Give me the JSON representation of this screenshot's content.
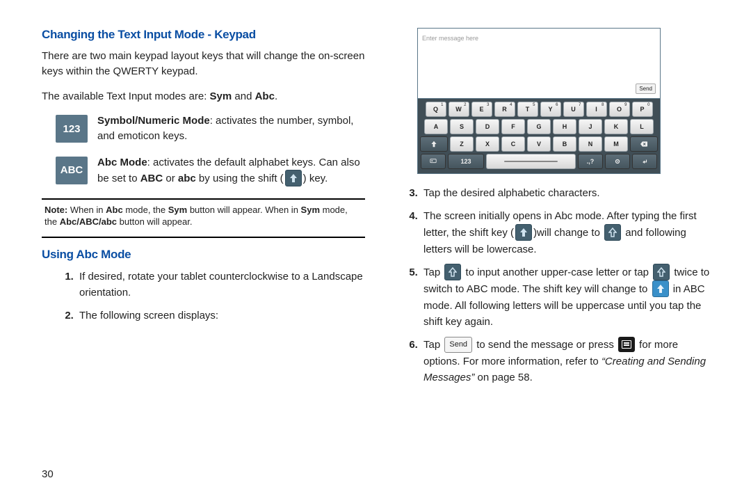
{
  "page_number": "30",
  "left": {
    "heading1": "Changing the Text Input Mode - Keypad",
    "para1": "There are two main keypad layout keys that will change the on-screen keys within the QWERTY keypad.",
    "para2_a": "The available Text Input modes are: ",
    "para2_sym": "Sym",
    "para2_and": " and ",
    "para2_abc": "Abc",
    "para2_end": ".",
    "mode123_badge": "123",
    "mode123_bold": "Symbol/Numeric Mode",
    "mode123_text": ": activates the number, symbol, and emoticon keys.",
    "modeABC_badge": "ABC",
    "modeABC_bold": "Abc Mode",
    "modeABC_text_a": ": activates the default alphabet keys. Can also be set to ",
    "modeABC_text_abc1": "ABC",
    "modeABC_text_or": " or ",
    "modeABC_text_abc2": "abc",
    "modeABC_text_b": " by using the shift (",
    "modeABC_text_c": ") key.",
    "note_prefix": "Note:",
    "note_a": " When in ",
    "note_abc": "Abc",
    "note_b": " mode, the ",
    "note_sym": "Sym",
    "note_c": " button will appear. When in ",
    "note_sym2": "Sym",
    "note_d": " mode, the ",
    "note_abcset": "Abc/ABC/abc",
    "note_e": " button will appear.",
    "heading2": "Using Abc Mode",
    "step1": "If desired, rotate your tablet counterclockwise to a Landscape orientation.",
    "step2": "The following screen displays:"
  },
  "right": {
    "msg_placeholder": "Enter message here",
    "send_label": "Send",
    "row1": [
      "Q",
      "W",
      "E",
      "R",
      "T",
      "Y",
      "U",
      "I",
      "O",
      "P"
    ],
    "row1_sup": [
      "1",
      "2",
      "3",
      "4",
      "5",
      "6",
      "7",
      "8",
      "9",
      "0"
    ],
    "row2": [
      "A",
      "S",
      "D",
      "F",
      "G",
      "H",
      "J",
      "K",
      "L"
    ],
    "row3": [
      "Z",
      "X",
      "C",
      "V",
      "B",
      "N",
      "M"
    ],
    "key_123": "123",
    "key_punct": ".,?",
    "step3": "Tap the desired alphabetic characters.",
    "step4_a": "The screen initially opens in Abc mode. After typing the first letter, the shift key (",
    "step4_b": ")will change to ",
    "step4_c": " and following letters will be lowercase.",
    "step5_a": "Tap ",
    "step5_b": " to input another upper-case letter or tap ",
    "step5_c": " twice to switch to ABC mode. The shift key will change to ",
    "step5_d": " in ABC mode. All following letters will be uppercase until you tap the shift key again.",
    "step6_a": "Tap ",
    "step6_b": " to send the message or press ",
    "step6_c": " for more options. For more information, refer to ",
    "step6_ref": "“Creating and Sending Messages”",
    "step6_d": "  on page 58."
  }
}
